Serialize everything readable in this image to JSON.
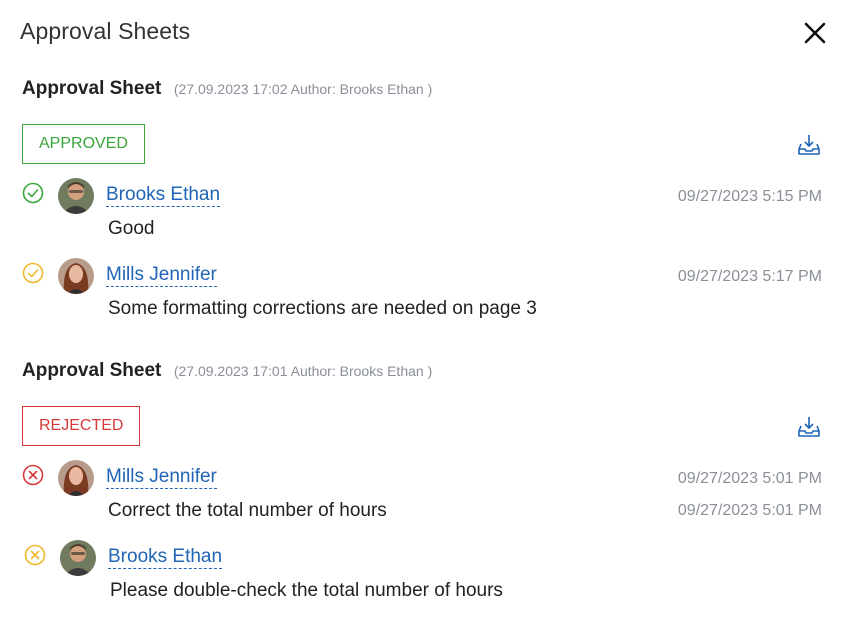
{
  "header": {
    "title": "Approval Sheets",
    "close_icon": "close-icon"
  },
  "colors": {
    "approved": "#3aa63a",
    "rejected": "#d63a3a",
    "pending": "#f0b92b",
    "link": "#1f64b5",
    "muted": "#8a8f99"
  },
  "sheets": [
    {
      "title": "Approval Sheet",
      "meta": "(27.09.2023 17:02 Author: Brooks Ethan )",
      "status": "APPROVED",
      "download_icon": "download-icon",
      "entries": [
        {
          "state_icon": "check-circle-icon",
          "name": "Brooks Ethan",
          "time": "09/27/2023 5:15 PM",
          "comment": "Good"
        },
        {
          "state_icon": "pending-check-circle-icon",
          "name": "Mills Jennifer",
          "time": "09/27/2023 5:17 PM",
          "comment": "Some formatting corrections are needed on page 3"
        }
      ]
    },
    {
      "title": "Approval Sheet",
      "meta": "(27.09.2023 17:01 Author: Brooks Ethan )",
      "status": "REJECTED",
      "download_icon": "download-icon",
      "entries": [
        {
          "state_icon": "reject-circle-icon",
          "name": "Mills Jennifer",
          "time": "09/27/2023 5:01 PM",
          "comment": "Correct the total number of hours"
        },
        {
          "state_icon": "pending-reject-circle-icon",
          "name": "Brooks Ethan",
          "time": "09/27/2023 5:01 PM",
          "comment": "Please double-check the total number of hours"
        }
      ]
    }
  ]
}
